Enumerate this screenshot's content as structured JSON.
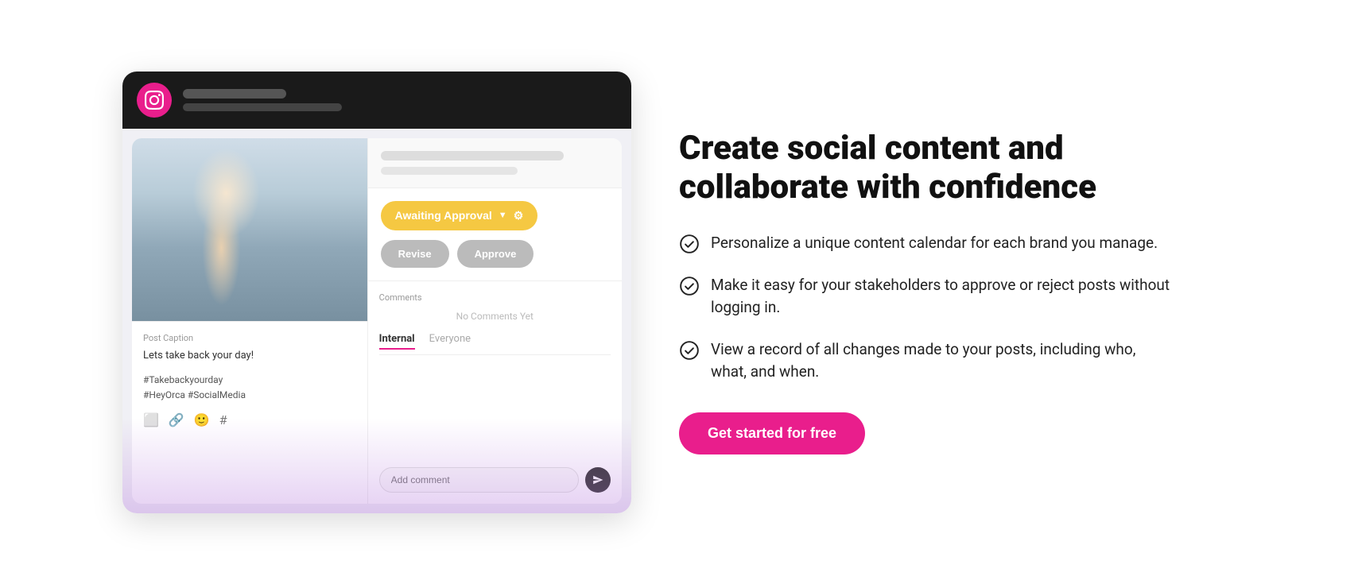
{
  "mock": {
    "platform_icon": "instagram",
    "topbar": {
      "line1": "",
      "line2": ""
    },
    "photo_alt": "Woman smiling at phone",
    "caption": {
      "label": "Post Caption",
      "text": "Lets take back your day!",
      "hashtags": "#Takebackyourday\n#HeyOrca #SocialMedia"
    },
    "approval": {
      "status_label": "Awaiting Approval",
      "revise_label": "Revise",
      "approve_label": "Approve"
    },
    "comments": {
      "label": "Comments",
      "empty_text": "No Comments Yet",
      "tab_internal": "Internal",
      "tab_everyone": "Everyone",
      "input_placeholder": "Add comment"
    }
  },
  "marketing": {
    "headline": "Create social content and collaborate with confidence",
    "features": [
      {
        "id": 1,
        "text": "Personalize a unique content calendar for each brand you manage."
      },
      {
        "id": 2,
        "text": "Make it easy for your stakeholders to approve or reject posts without logging in."
      },
      {
        "id": 3,
        "text": "View a record of all changes made to your posts, including who, what, and when."
      }
    ],
    "cta_label": "Get started for free"
  }
}
